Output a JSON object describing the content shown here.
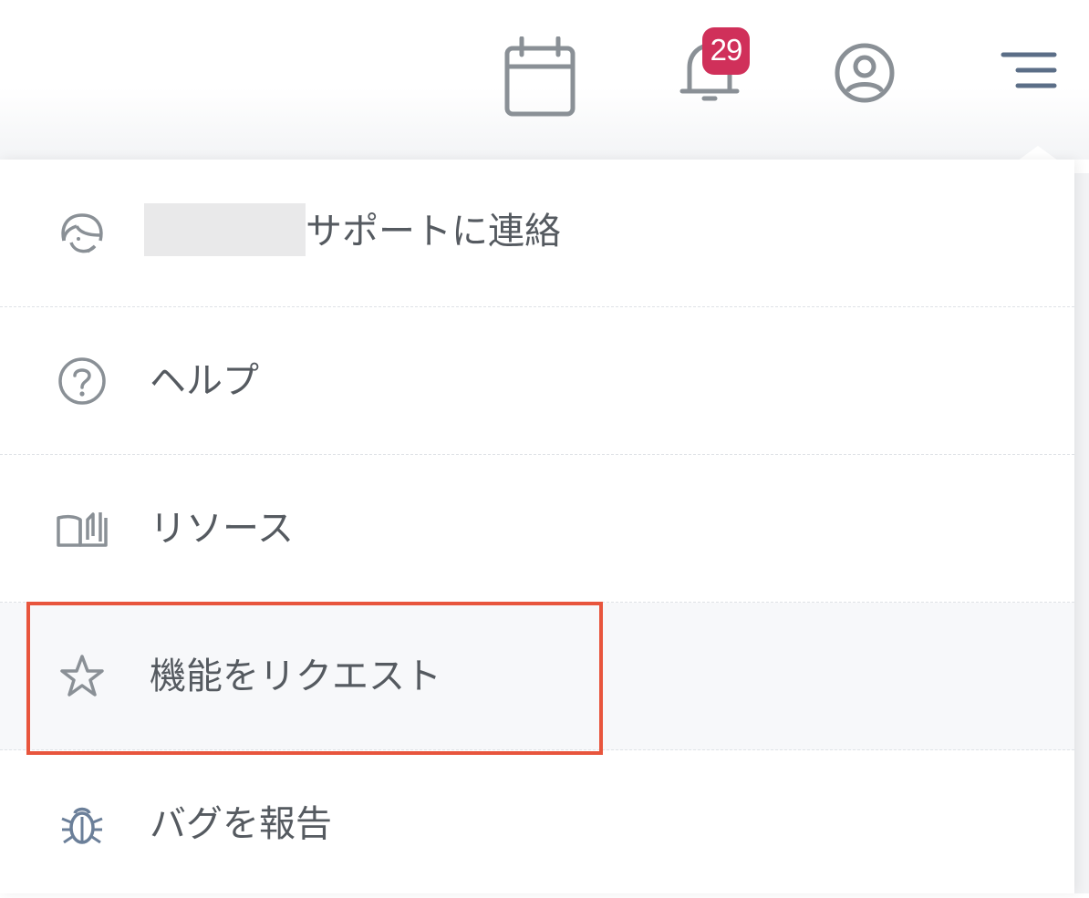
{
  "header": {
    "icons": [
      "calendar-icon",
      "bell-icon",
      "user-circle-icon",
      "menu-icon"
    ],
    "notification_count": "29",
    "badge_color": "#d0305a"
  },
  "menu": {
    "items": [
      {
        "icon": "support-agent-icon",
        "label": "サポートに連絡",
        "redacted_prefix": true
      },
      {
        "icon": "help-circle-icon",
        "label": "ヘルプ"
      },
      {
        "icon": "book-icon",
        "label": "リソース"
      },
      {
        "icon": "star-icon",
        "label": "機能をリクエスト",
        "highlighted": true
      },
      {
        "icon": "bug-icon",
        "label": "バグを報告"
      }
    ]
  },
  "colors": {
    "text": "#555a60",
    "icon": "#8a9096",
    "highlight_border": "#e8553d",
    "row_highlight_bg": "#f7f8fa"
  }
}
